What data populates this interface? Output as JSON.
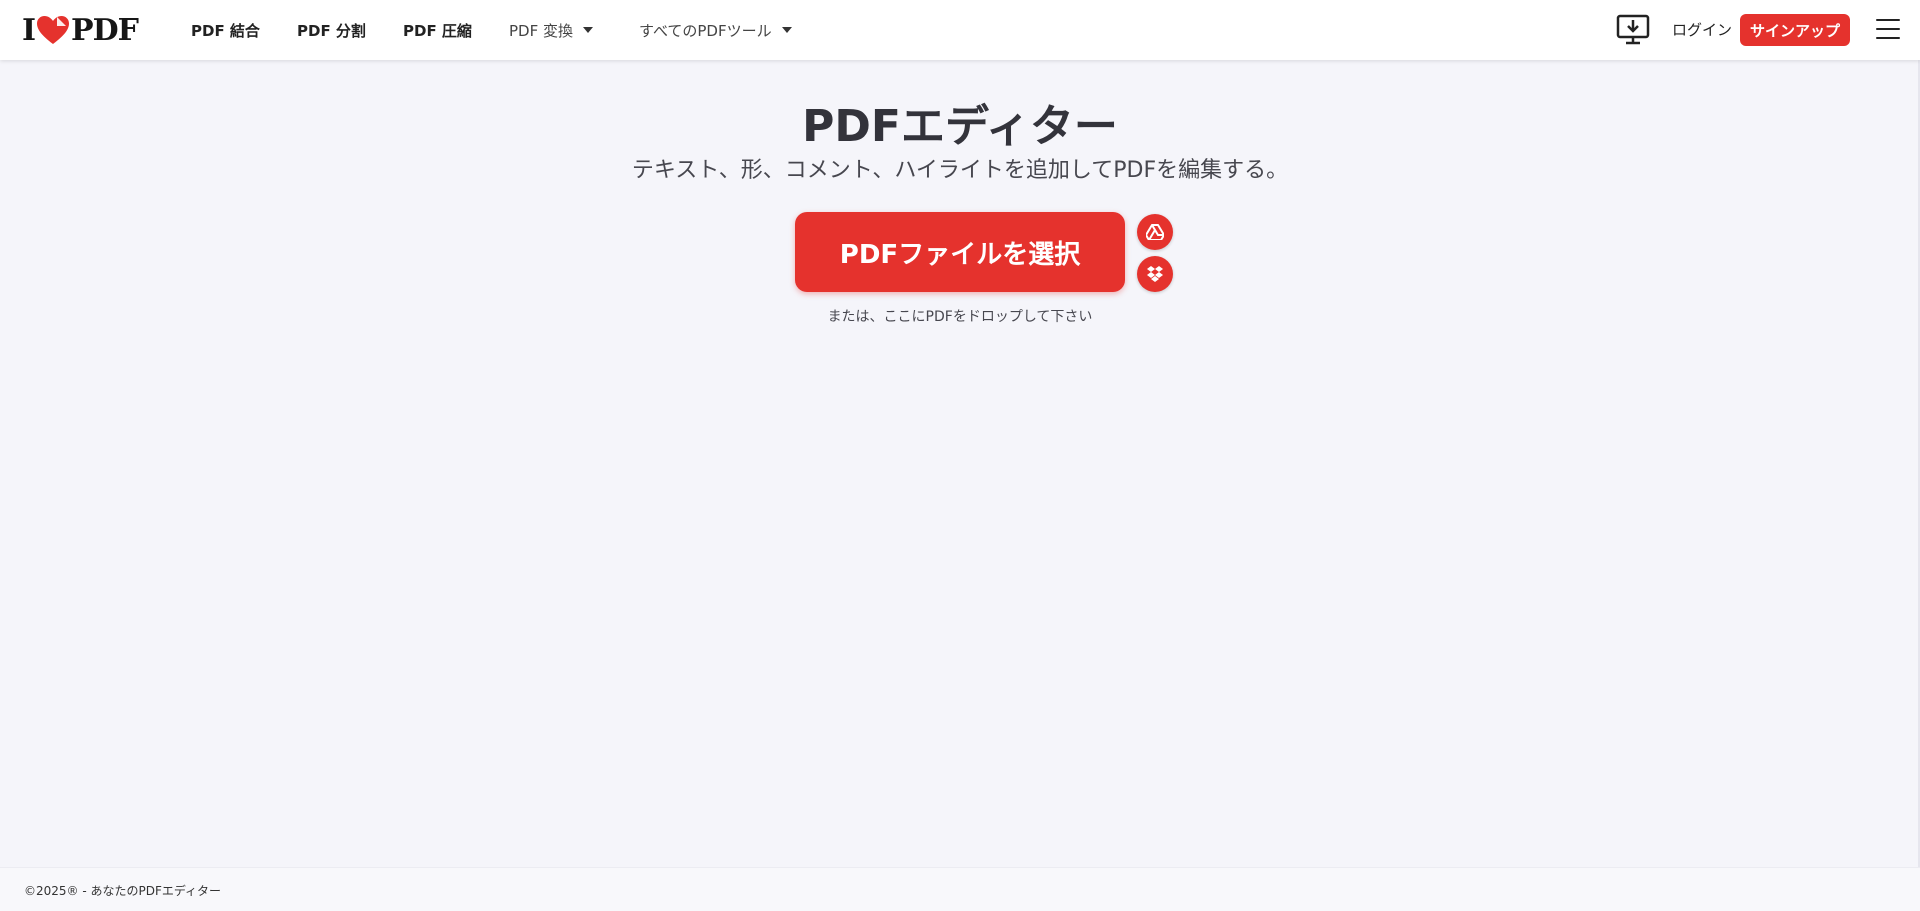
{
  "header": {
    "logo": {
      "prefix": "I",
      "suffix": "PDF",
      "heart_color": "#e5322d"
    },
    "nav": [
      {
        "label": "PDF 結合",
        "has_dropdown": false
      },
      {
        "label": "PDF 分割",
        "has_dropdown": false
      },
      {
        "label": "PDF 圧縮",
        "has_dropdown": false
      },
      {
        "label": "PDF 変換",
        "has_dropdown": true
      },
      {
        "label": "すべてのPDFツール",
        "has_dropdown": true
      }
    ],
    "desktop_icon": "desktop-download-icon",
    "login_label": "ログイン",
    "signup_label": "サインアップ",
    "menu_icon": "hamburger-menu-icon"
  },
  "main": {
    "title": "PDFエディター",
    "subtitle": "テキスト、形、コメント、ハイライトを追加してPDFを編集する。",
    "upload_button_label": "PDFファイルを選択",
    "cloud_buttons": [
      {
        "icon": "google-drive-icon"
      },
      {
        "icon": "dropbox-icon"
      }
    ],
    "drop_hint": "または、ここにPDFをドロップして下さい"
  },
  "footer": {
    "copyright": "©2025® - あなたのPDFエディター"
  },
  "colors": {
    "accent": "#e5322d",
    "background": "#f5f5fa",
    "text": "#33333b"
  }
}
